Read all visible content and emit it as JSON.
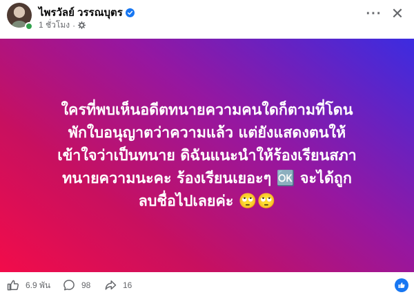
{
  "header": {
    "author_name": "ไพรวัลย์ วรรณบุตร",
    "timestamp": "1 ชั่วโมง",
    "more_icon": "more-horizontal-icon",
    "close_icon": "close-icon"
  },
  "post": {
    "text": "ใครที่พบเห็นอดีตทนายความคนใดก็ตามที่โดน\nพักใบอนุญาตว่าความแล้ว แต่ยังแสดงตนให้\nเข้าใจว่าเป็นทนาย ดิฉันแนะนำให้ร้องเรียนสภา\nทนายความนะคะ ร้องเรียนเยอะๆ 🆗 จะได้ถูก\nลบชื่อไปเลยค่ะ 🙄🙄",
    "background_colors": [
      "#f20c4a",
      "#c8105f",
      "#9617a0",
      "#3c2ce0"
    ]
  },
  "footer": {
    "likes": "6.9 พัน",
    "comments": "98",
    "shares": "16"
  },
  "colors": {
    "accent": "#1877f2",
    "verified": "#1877f2",
    "online": "#31a24c",
    "secondary_text": "#65676b"
  }
}
